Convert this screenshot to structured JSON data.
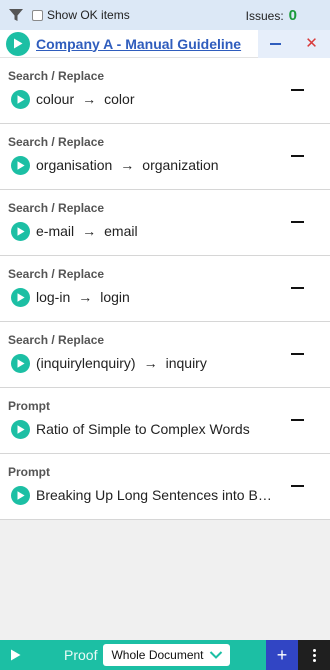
{
  "filter_bar": {
    "show_ok_label": "Show OK items",
    "show_ok_checked": false,
    "issues_label": "Issues:",
    "issues_count": "0"
  },
  "guideline": {
    "title": "Company A - Manual Guideline"
  },
  "items": [
    {
      "type": "Search / Replace",
      "from": "colour",
      "arrow": "→",
      "to": "color"
    },
    {
      "type": "Search / Replace",
      "from": "organisation",
      "arrow": "→",
      "to": "organization"
    },
    {
      "type": "Search / Replace",
      "from": "e-mail",
      "arrow": "→",
      "to": "email"
    },
    {
      "type": "Search / Replace",
      "from": "log-in",
      "arrow": "→",
      "to": "login"
    },
    {
      "type": "Search / Replace",
      "from": "(inquirylenquiry)",
      "arrow": "→",
      "to": "inquiry"
    },
    {
      "type": "Prompt",
      "text": "Ratio of Simple to Complex Words"
    },
    {
      "type": "Prompt",
      "text": "Breaking Up Long Sentences into B…"
    }
  ],
  "bottom_bar": {
    "proof_label": "Proof",
    "scope_value": "Whole Document",
    "add_label": "+"
  },
  "colors": {
    "accent_teal": "#1cbfa4",
    "link_blue": "#2f5dbd",
    "issues_green": "#1a9a3a",
    "add_button_blue": "#3145c4"
  }
}
